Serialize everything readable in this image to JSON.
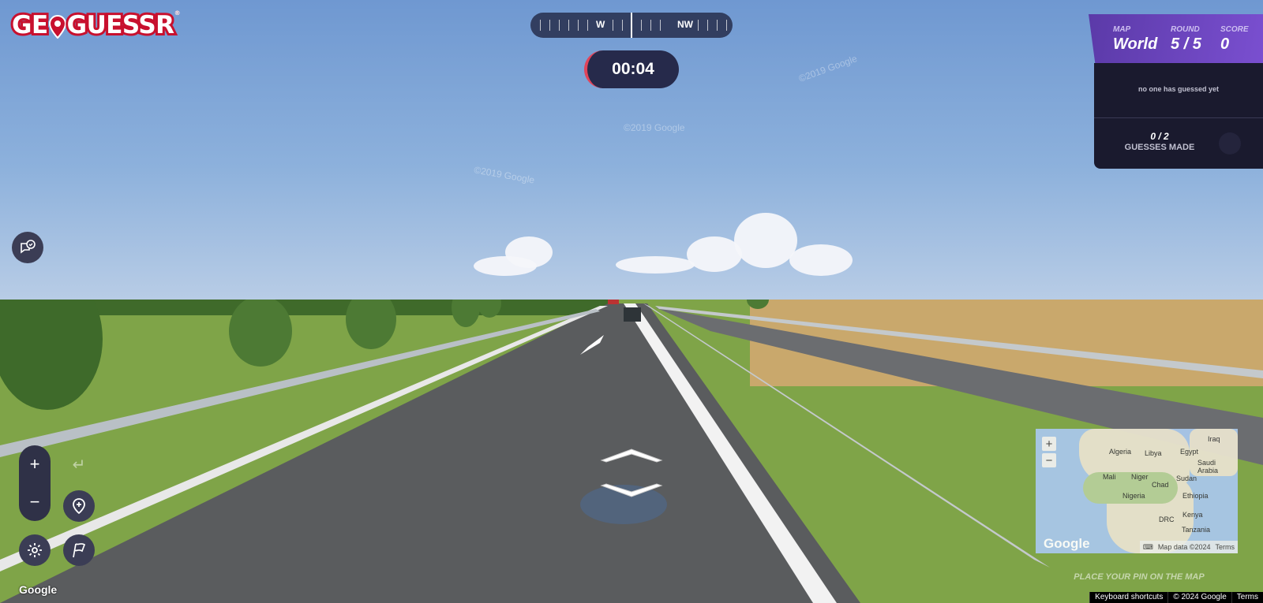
{
  "logo": {
    "text_left": "GE",
    "text_right": "GUESSR",
    "registered": "®"
  },
  "compass": {
    "directions": [
      "W",
      "NW"
    ]
  },
  "timer": {
    "value": "00:04"
  },
  "status": {
    "map_label": "MAP",
    "map_value": "World",
    "round_label": "ROUND",
    "round_value": "5 / 5",
    "score_label": "SCORE",
    "score_value": "0"
  },
  "guesses": {
    "none_text": "no one has guessed yet",
    "count": "0 / 2",
    "label": "GUESSES MADE"
  },
  "minimap": {
    "labels": [
      "Algeria",
      "Libya",
      "Egypt",
      "Iraq",
      "Saudi Arabia",
      "Mali",
      "Niger",
      "Chad",
      "Sudan",
      "Nigeria",
      "Ethiopia",
      "Kenya",
      "DRC",
      "Tanzania"
    ],
    "google": "Google",
    "keyboard_icon": "keyboard-icon",
    "map_data": "Map data ©2024",
    "terms": "Terms",
    "place_pin": "PLACE YOUR PIN ON THE MAP"
  },
  "streetview": {
    "google": "Google",
    "keyboard_shortcuts": "Keyboard shortcuts",
    "copyright": "© 2024 Google",
    "terms": "Terms",
    "watermark": "©2019 Google"
  },
  "icons": {
    "chat": "chat-icon",
    "zoom_in": "plus-icon",
    "zoom_out": "minus-icon",
    "undo": "undo-icon",
    "pin": "pin-icon",
    "settings": "gear-icon",
    "flag": "flag-icon",
    "move_forward": "chevron-up-icon",
    "move_back": "chevron-down-icon"
  },
  "colors": {
    "brand_red": "#c8102e",
    "status_purple": "#6b45c0",
    "panel_dark": "#1a1a2e"
  }
}
